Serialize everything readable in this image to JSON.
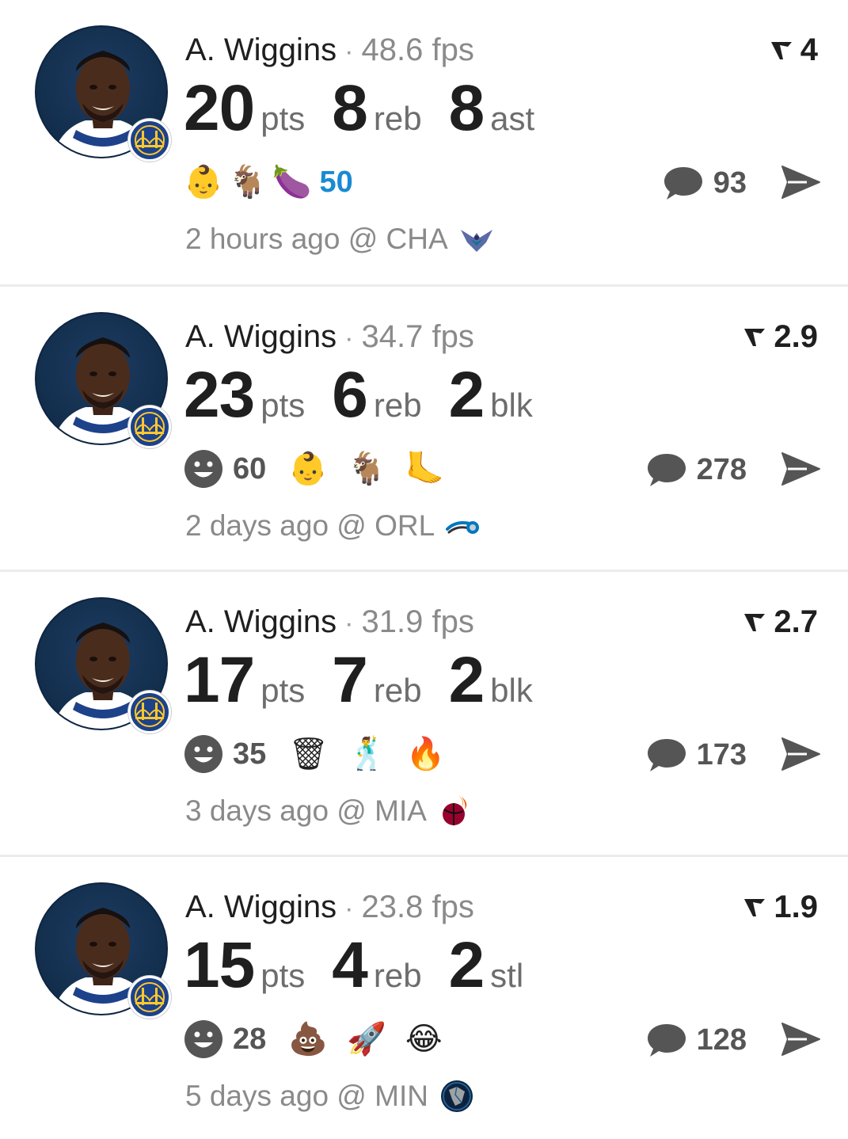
{
  "feed": {
    "posts": [
      {
        "player": "A. Wiggins",
        "separator": "·",
        "fps": "48.6 fps",
        "rank": "4",
        "stats": [
          {
            "value": "20",
            "unit": "pts"
          },
          {
            "value": "8",
            "unit": "reb"
          },
          {
            "value": "8",
            "unit": "ast"
          }
        ],
        "reactions": {
          "style": "top-emojis",
          "emojis": [
            "👶",
            "🐐",
            "🍆"
          ],
          "count": "50"
        },
        "comments": "93",
        "time": "2 hours ago @ CHA",
        "opponent_icon": "hornets-logo-icon"
      },
      {
        "player": "A. Wiggins",
        "separator": "·",
        "fps": "34.7 fps",
        "rank": "2.9",
        "stats": [
          {
            "value": "23",
            "unit": "pts"
          },
          {
            "value": "6",
            "unit": "reb"
          },
          {
            "value": "2",
            "unit": "blk"
          }
        ],
        "reactions": {
          "style": "smiley-count",
          "count": "60",
          "emojis": [
            "👶",
            "🐐",
            "🦶"
          ]
        },
        "comments": "278",
        "time": "2 days ago @ ORL",
        "opponent_icon": "magic-logo-icon"
      },
      {
        "player": "A. Wiggins",
        "separator": "·",
        "fps": "31.9 fps",
        "rank": "2.7",
        "stats": [
          {
            "value": "17",
            "unit": "pts"
          },
          {
            "value": "7",
            "unit": "reb"
          },
          {
            "value": "2",
            "unit": "blk"
          }
        ],
        "reactions": {
          "style": "smiley-count",
          "count": "35",
          "emojis": [
            "🗑",
            "🕺",
            "🔥"
          ]
        },
        "comments": "173",
        "time": "3 days ago @ MIA",
        "opponent_icon": "heat-logo-icon"
      },
      {
        "player": "A. Wiggins",
        "separator": "·",
        "fps": "23.8 fps",
        "rank": "1.9",
        "stats": [
          {
            "value": "15",
            "unit": "pts"
          },
          {
            "value": "4",
            "unit": "reb"
          },
          {
            "value": "2",
            "unit": "stl"
          }
        ],
        "reactions": {
          "style": "smiley-count",
          "count": "28",
          "emojis": [
            "💩",
            "🚀",
            "😂"
          ]
        },
        "comments": "128",
        "time": "5 days ago @ MIN",
        "opponent_icon": "timberwolves-logo-icon"
      }
    ]
  },
  "colors": {
    "text_primary": "#1f1f1f",
    "text_secondary": "#8a8a8a",
    "accent_blue": "#1a8ad4",
    "icon_gray": "#555555",
    "team_navy": "#1d428a",
    "team_gold": "#ffc72c"
  }
}
